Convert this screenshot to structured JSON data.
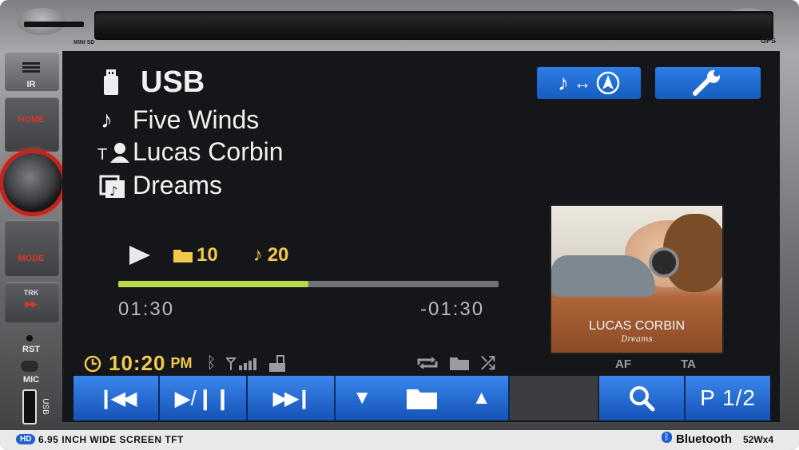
{
  "bezel": {
    "mini_sd_label": "MINI SD",
    "gps_label": "GPS",
    "ir_label": "IR",
    "home_label": "HOME",
    "mode_label": "MODE",
    "trk_label": "TRK",
    "rst_label": "RST",
    "mic_label": "MIC",
    "usb_label": "USB",
    "hd_badge": "HD",
    "screen_spec": "6.95 INCH WIDE SCREEN TFT",
    "bluetooth_brand": "Bluetooth",
    "power_spec": "52Wx4"
  },
  "screen": {
    "source": "USB",
    "track_title": "Five Winds",
    "artist": "Lucas Corbin",
    "album": "Dreams",
    "folder_number": "10",
    "track_number": "20",
    "elapsed": "01:30",
    "remaining": "-01:30",
    "progress": 0.5,
    "clock_time": "10:20",
    "clock_ampm": "PM",
    "af_label": "AF",
    "ta_label": "TA",
    "page_label": "P 1/2",
    "album_cover_title": "LUCAS CORBIN",
    "album_cover_subtitle": "Dreams"
  },
  "colors": {
    "accent_blue": "#1f6fe0",
    "yellow": "#f2c94c",
    "progress_fill": "#b8d94a",
    "home_red": "#e0342a"
  },
  "icons": [
    "usb-icon",
    "music-note-icon",
    "artist-icon",
    "album-icon",
    "play-icon",
    "folder-icon",
    "clock-icon",
    "bluetooth-icon",
    "signal-icon",
    "phone-icon",
    "repeat-icon",
    "shuffle-icon",
    "navigation-icon",
    "wrench-icon",
    "prev-track-icon",
    "play-pause-icon",
    "next-track-icon",
    "down-arrow-icon",
    "up-arrow-icon",
    "search-icon"
  ]
}
